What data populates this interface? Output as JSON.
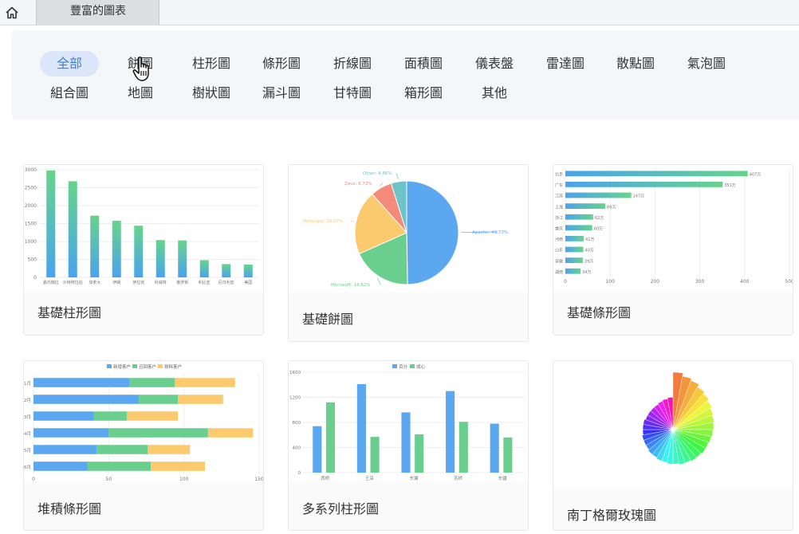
{
  "tab": {
    "title": "豐富的圖表"
  },
  "filters": [
    "全部",
    "餅圖",
    "柱形圖",
    "條形圖",
    "折線圖",
    "面積圖",
    "儀表盤",
    "雷達圖",
    "散點圖",
    "氣泡圖",
    "組合圖",
    "地圖",
    "樹狀圖",
    "漏斗圖",
    "甘特圖",
    "箱形圖",
    "其他"
  ],
  "active_filter": "全部",
  "cards": [
    {
      "title": "基礎柱形圖"
    },
    {
      "title": "基礎餅圖"
    },
    {
      "title": "基礎條形圖"
    },
    {
      "title": "堆積條形圖"
    },
    {
      "title": "多系列柱形圖"
    },
    {
      "title": "南丁格爾玫瑰圖"
    }
  ],
  "icons": {
    "home": "home-icon",
    "cursor": "hand-pointer-icon"
  },
  "colors": {
    "active_bg": "#dbe7f8",
    "active_text": "#3f7fd6",
    "blue": "#5ba7f0",
    "green": "#6acf8e",
    "orange": "#fbc96e",
    "red": "#f48a7a",
    "teal": "#6cc3c8"
  },
  "chart_data": [
    {
      "type": "bar",
      "categories": [
        "委内瑞拉",
        "沙特阿拉伯",
        "加拿大",
        "伊朗",
        "伊拉克",
        "科威特",
        "俄罗斯",
        "利比亚",
        "尼日利亚",
        "美国"
      ],
      "values": [
        2980,
        2680,
        1720,
        1580,
        1440,
        1040,
        1030,
        480,
        370,
        360
      ],
      "yticks": [
        "0",
        "500",
        "1000",
        "1500",
        "2000",
        "2500",
        "3000"
      ],
      "ylim": [
        0,
        3000
      ]
    },
    {
      "type": "pie",
      "slices": [
        {
          "name": "Apache",
          "value": 49.73,
          "label": "Apache: 49.73%",
          "color": "#5ba7f0"
        },
        {
          "name": "Microsoft",
          "value": 18.62,
          "label": "Microsoft: 18.62%",
          "color": "#6acf8e"
        },
        {
          "name": "Netscape",
          "value": 20.07,
          "label": "Netscape: 20.07%",
          "color": "#fbc96e"
        },
        {
          "name": "Zeus",
          "value": 6.73,
          "label": "Zeus: 6.73%",
          "color": "#f48a7a"
        },
        {
          "name": "Other",
          "value": 4.86,
          "label": "Other: 4.86%",
          "color": "#6cc3c8"
        }
      ]
    },
    {
      "type": "bar",
      "orientation": "horizontal",
      "categories": [
        "北京",
        "广东",
        "江苏",
        "上海",
        "浙江",
        "重庆",
        "河南",
        "山东",
        "安徽",
        "湖南"
      ],
      "values": [
        407,
        351,
        147,
        89,
        62,
        60,
        41,
        40,
        39,
        34
      ],
      "labels": [
        "407万",
        "351万",
        "147万",
        "89万",
        "62万",
        "60万",
        "41万",
        "40万",
        "39万",
        "34万"
      ],
      "xticks": [
        "0",
        "100",
        "200",
        "300",
        "400",
        "500"
      ],
      "xlim": [
        0,
        500
      ]
    },
    {
      "type": "bar",
      "orientation": "horizontal",
      "stacked": true,
      "categories": [
        "1月",
        "2月",
        "3月",
        "4月",
        "5月",
        "6月"
      ],
      "series": [
        {
          "name": "新增客户",
          "values": [
            64,
            70,
            40,
            50,
            42,
            36
          ],
          "color": "#5ba7f0"
        },
        {
          "name": "召回客户",
          "values": [
            30,
            26,
            22,
            66,
            34,
            42
          ],
          "color": "#6acf8e"
        },
        {
          "name": "损耗客户",
          "values": [
            40,
            30,
            34,
            30,
            28,
            36
          ],
          "color": "#fbc96e"
        }
      ],
      "xticks": [
        "0",
        "50",
        "100",
        "150"
      ],
      "xlim": [
        0,
        150
      ]
    },
    {
      "type": "bar",
      "categories": [
        "西桥",
        "王店",
        "东塘",
        "苏桥",
        "东疆"
      ],
      "series": [
        {
          "name": "百分",
          "values": [
            740,
            1410,
            960,
            1300,
            780
          ],
          "color": "#5ba7f0"
        },
        {
          "name": "成心",
          "values": [
            1120,
            570,
            610,
            810,
            560
          ],
          "color": "#6acf8e"
        }
      ],
      "yticks": [
        "0",
        "400",
        "800",
        "1200",
        "1600"
      ],
      "ylim": [
        0,
        1600
      ]
    },
    {
      "type": "pie",
      "variant": "nightingale-rose",
      "values": [
        55,
        52,
        50,
        47,
        45,
        43,
        41,
        40,
        39,
        38,
        37,
        36,
        36,
        35,
        35,
        34,
        34,
        33,
        33,
        32,
        32,
        31,
        31,
        30,
        30,
        30,
        29,
        29,
        29,
        28,
        28,
        28,
        28,
        29,
        30,
        31
      ]
    }
  ]
}
